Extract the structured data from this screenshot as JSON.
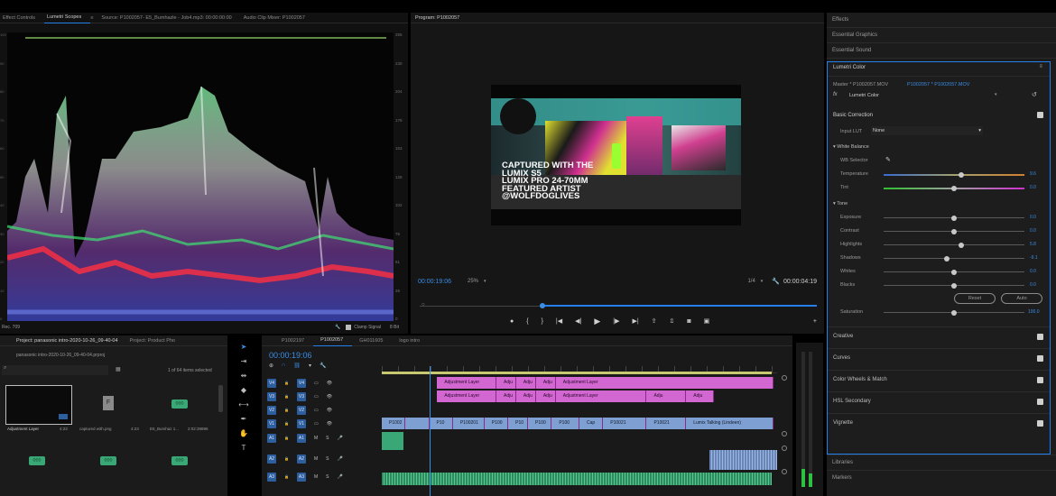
{
  "scopes": {
    "tabs": [
      "Effect Controls",
      "Lumetri Scopes",
      "Source: P1002057- E5_Bumhazle - Job4.mp3: 00:00:00:00",
      "Audio Clip Mixer: P1002057"
    ],
    "scale_right": [
      "255",
      "230",
      "204",
      "178",
      "153",
      "128",
      "102",
      "76",
      "51",
      "26",
      "0"
    ],
    "scale_left": [
      "100",
      "90",
      "80",
      "70",
      "60",
      "50",
      "40",
      "30",
      "20",
      "10",
      "0"
    ],
    "footer_left": "Rec. 709",
    "clamp_label": "Clamp Signal",
    "bit_label": "8 Bit"
  },
  "program": {
    "title": "Program: P1002057",
    "overlay_lines": [
      "CAPTURED WITH THE",
      "LUMIX S5",
      "LUMIX PRO 24-70MM",
      "FEATURED ARTIST",
      "@WOLFDOGLIVES"
    ],
    "timecode_left": "00:00:19:06",
    "zoom": "25%",
    "fraction": "1/4",
    "timecode_right": "00:00:04:19",
    "playhead_fraction": 0.31
  },
  "right_panel": {
    "collapsed": [
      "Effects",
      "Essential Graphics",
      "Essential Sound"
    ],
    "bottom": [
      "Libraries",
      "Markers"
    ]
  },
  "lumetri": {
    "title": "Lumetri Color",
    "master": "Master * P1002057.MOV",
    "clip": "P1002057 * P1002057.MOV",
    "effect": "Lumetri Color",
    "basic": "Basic Correction",
    "input_lut_label": "Input LUT",
    "input_lut_value": "None",
    "white_balance": "White Balance",
    "wb_selector": "WB Selector",
    "temperature": {
      "label": "Temperature",
      "value": "9.6",
      "pos": 0.55
    },
    "tint": {
      "label": "Tint",
      "value": "0.0",
      "pos": 0.5
    },
    "tone": "Tone",
    "tone_sliders": [
      {
        "label": "Exposure",
        "value": "0.0",
        "pos": 0.5
      },
      {
        "label": "Contrast",
        "value": "0.0",
        "pos": 0.5
      },
      {
        "label": "Highlights",
        "value": "5.8",
        "pos": 0.55
      },
      {
        "label": "Shadows",
        "value": "-9.1",
        "pos": 0.45
      },
      {
        "label": "Whites",
        "value": "0.0",
        "pos": 0.5
      },
      {
        "label": "Blacks",
        "value": "0.0",
        "pos": 0.5
      }
    ],
    "reset": "Reset",
    "auto": "Auto",
    "saturation": {
      "label": "Saturation",
      "value": "100.0",
      "pos": 0.5
    },
    "sections": [
      "Creative",
      "Curves",
      "Color Wheels & Match",
      "HSL Secondary",
      "Vignette"
    ]
  },
  "project": {
    "tabs": [
      "Project: panasonic intro-2020-10-26_09-40-04",
      "Project: Product Pho"
    ],
    "path": "panasonic intro-2020-10-26_09-40-04.prproj",
    "count": "1 of 64 items selected",
    "items": [
      {
        "name": "Adjustment Layer",
        "dur": "4:23",
        "kind": "black"
      },
      {
        "name": "captured with.png",
        "dur": "4:23",
        "kind": "file"
      },
      {
        "name": "E5_Bumhaz 1...",
        "dur": "2:02:39896",
        "kind": "audio"
      }
    ],
    "row2_count": 3
  },
  "timeline": {
    "tabs": [
      "P1002197",
      "P1002057",
      "GH011605",
      "logo intro"
    ],
    "active_tab": 1,
    "timecode": "00:00:19:06",
    "video_tracks": [
      "V4",
      "V3",
      "V2",
      "V1"
    ],
    "audio_tracks": [
      "A1",
      "A2",
      "A3"
    ],
    "src_v": "V1",
    "src_a": "A1",
    "v4": [
      {
        "label": "Adjustment Layer",
        "start": 0.14,
        "end": 0.29
      },
      {
        "label": "Adju",
        "start": 0.29,
        "end": 0.34
      },
      {
        "label": "Adju",
        "start": 0.34,
        "end": 0.39
      },
      {
        "label": "Adju",
        "start": 0.39,
        "end": 0.44
      },
      {
        "label": "Adjustment Layer",
        "start": 0.44,
        "end": 0.99
      }
    ],
    "v3": [
      {
        "label": "Adjustment Layer",
        "start": 0.14,
        "end": 0.29
      },
      {
        "label": "Adju",
        "start": 0.29,
        "end": 0.34
      },
      {
        "label": "Adju",
        "start": 0.34,
        "end": 0.39
      },
      {
        "label": "Adju",
        "start": 0.39,
        "end": 0.44
      },
      {
        "label": "Adjustment Layer",
        "start": 0.44,
        "end": 0.67
      },
      {
        "label": "Adju",
        "start": 0.67,
        "end": 0.77
      },
      {
        "label": "Adju",
        "start": 0.77,
        "end": 0.84
      }
    ],
    "v1": [
      {
        "label": "P1002",
        "start": 0.0,
        "end": 0.06
      },
      {
        "label": "",
        "start": 0.06,
        "end": 0.12
      },
      {
        "label": "P10",
        "start": 0.12,
        "end": 0.18
      },
      {
        "label": "P100201",
        "start": 0.18,
        "end": 0.26
      },
      {
        "label": "P100",
        "start": 0.26,
        "end": 0.32
      },
      {
        "label": "P10",
        "start": 0.32,
        "end": 0.37
      },
      {
        "label": "P100",
        "start": 0.37,
        "end": 0.43
      },
      {
        "label": "P100",
        "start": 0.43,
        "end": 0.5
      },
      {
        "label": "Cap",
        "start": 0.5,
        "end": 0.56
      },
      {
        "label": "P10021",
        "start": 0.56,
        "end": 0.67
      },
      {
        "label": "P10021",
        "start": 0.67,
        "end": 0.77
      },
      {
        "label": "Lumix Talking (Lindeen)",
        "start": 0.77,
        "end": 0.99
      }
    ],
    "playhead": 0.12
  }
}
